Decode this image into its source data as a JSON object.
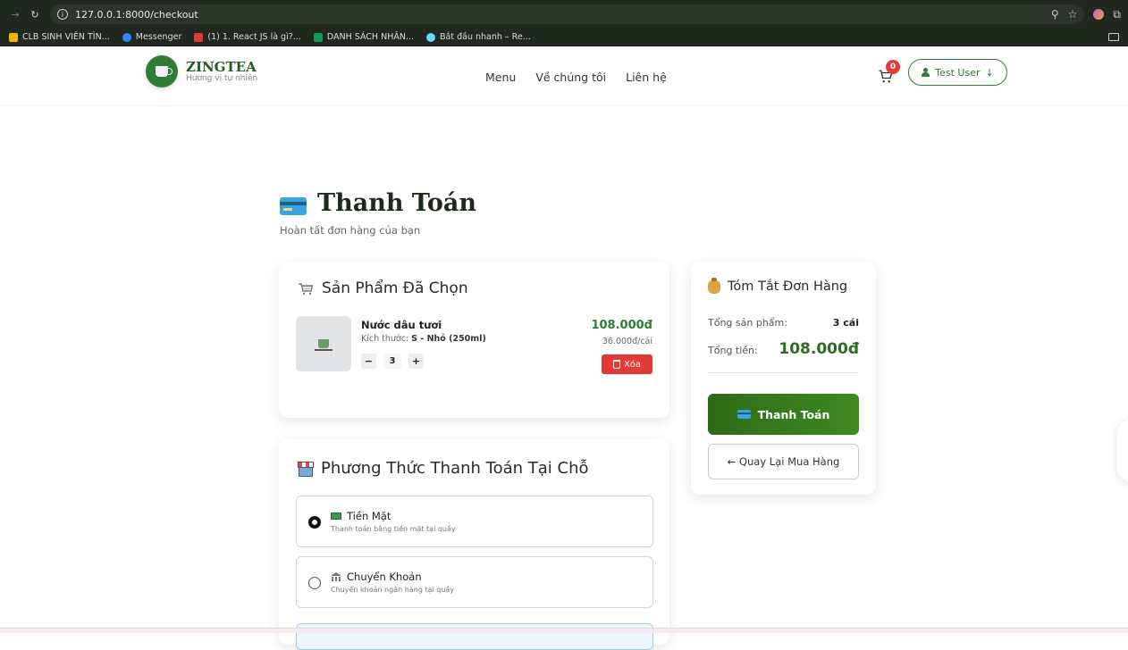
{
  "browser": {
    "url": "127.0.0.1:8000/checkout",
    "bookmarks": [
      {
        "label": "CLB SINH VIÊN TÌN...",
        "color": "#f4b400"
      },
      {
        "label": "Messenger",
        "color": "#2d88ff"
      },
      {
        "label": "(1) 1. React JS là gì?...",
        "color": "#e53935"
      },
      {
        "label": "DANH SÁCH NHÂN...",
        "color": "#0f9d58"
      },
      {
        "label": "Bắt đầu nhanh – Re...",
        "color": "#61dafb"
      }
    ]
  },
  "header": {
    "brand": "ZINGTEA",
    "tagline": "Hương vị tự nhiên",
    "nav": [
      "Menu",
      "Về chúng tôi",
      "Liên hệ"
    ],
    "cart_count": "0",
    "user_label": "Test User",
    "user_arrow": "↓"
  },
  "page": {
    "title": "Thanh Toán",
    "subtitle": "Hoàn tất đơn hàng của bạn"
  },
  "products": {
    "heading": "Sản Phẩm Đã Chọn",
    "items": [
      {
        "name": "Nước dâu tươi",
        "size_label": "Kích thước:",
        "size_value": "S - Nhỏ (250ml)",
        "quantity": "3",
        "total": "108.000đ",
        "unit_price": "36.000đ/cái",
        "delete_label": "Xóa"
      }
    ]
  },
  "summary": {
    "heading": "Tóm Tắt Đơn Hàng",
    "count_label": "Tổng sản phẩm:",
    "count_value": "3 cái",
    "total_label": "Tổng tiền:",
    "total_value": "108.000đ",
    "pay_label": "Thanh Toán",
    "back_label": "← Quay Lại Mua Hàng"
  },
  "payment": {
    "heading": "Phương Thức Thanh Toán Tại Chỗ",
    "options": [
      {
        "title": "Tiền Mặt",
        "desc": "Thanh toán bằng tiền mặt tại quầy",
        "checked": true,
        "icon": "cash-icon"
      },
      {
        "title": "Chuyển Khoản",
        "desc": "Chuyển khoản ngân hàng tại quầy",
        "checked": false,
        "icon": "bank-icon"
      }
    ]
  },
  "colors": {
    "brand": "#2e7d32",
    "danger": "#e53935",
    "price": "#2e7d32"
  }
}
